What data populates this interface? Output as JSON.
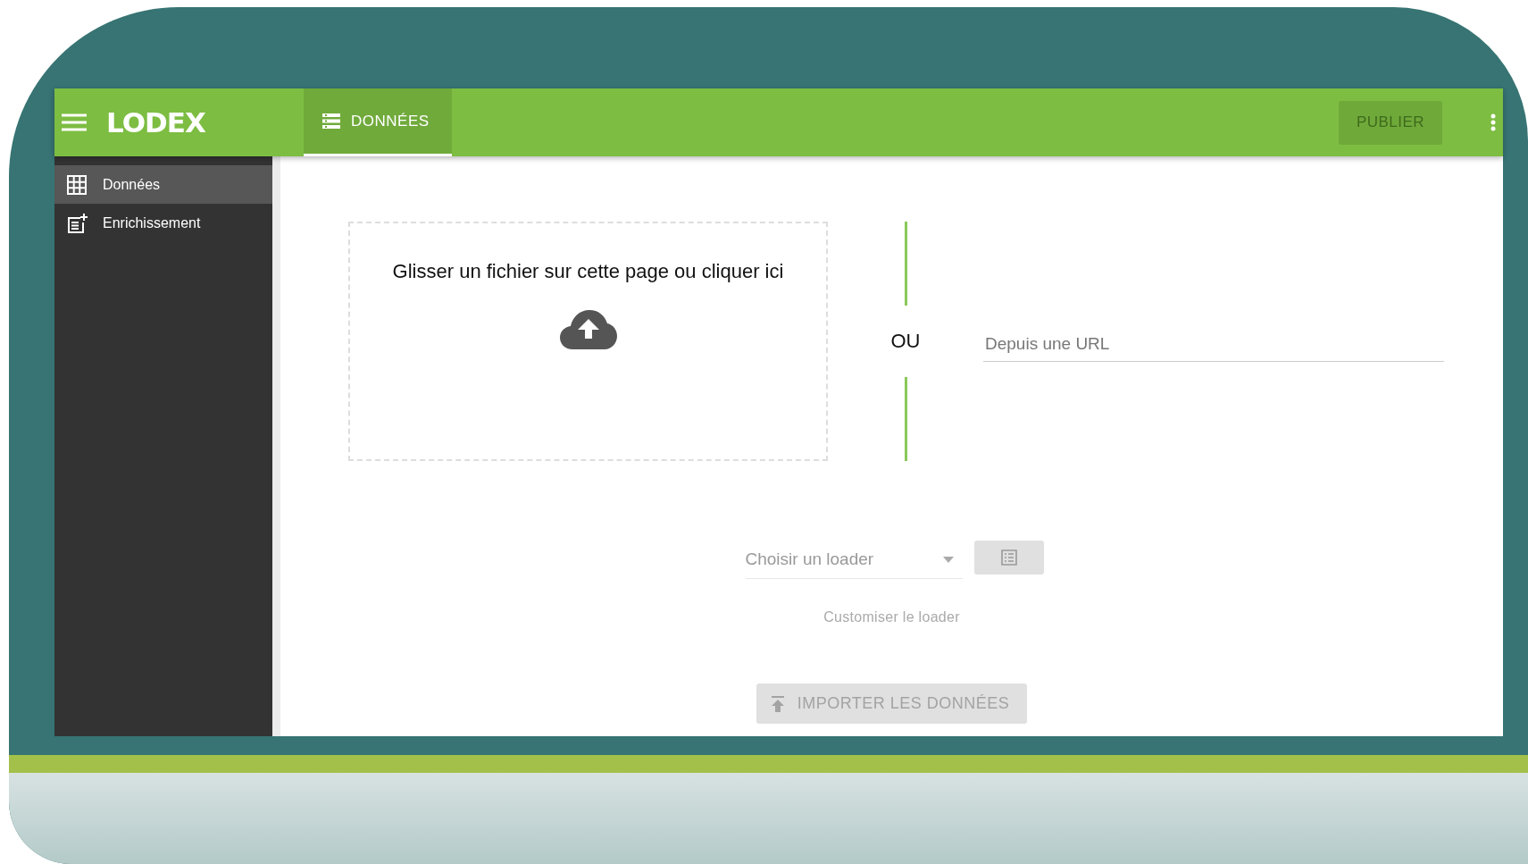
{
  "header": {
    "logo": "LODEX",
    "tabs": [
      {
        "label": "DONNÉES",
        "selected": true
      }
    ],
    "publish_button": {
      "label": "PUBLIER",
      "disabled": true
    }
  },
  "sidebar": {
    "items": [
      {
        "label": "Données",
        "selected": true,
        "kind": "grid"
      },
      {
        "label": "Enrichissement",
        "selected": false,
        "kind": "note-add"
      }
    ]
  },
  "upload": {
    "dropzone_text": "Glisser un fichier sur cette page ou cliquer ici",
    "separator": "OU",
    "url_field": {
      "placeholder": "Depuis une URL"
    }
  },
  "loader": {
    "select": {
      "placeholder": "Choisir un loader"
    },
    "customize_link": "Customiser le loader",
    "import_button": {
      "label": "IMPORTER LES DONNÉES",
      "disabled": true
    }
  }
}
